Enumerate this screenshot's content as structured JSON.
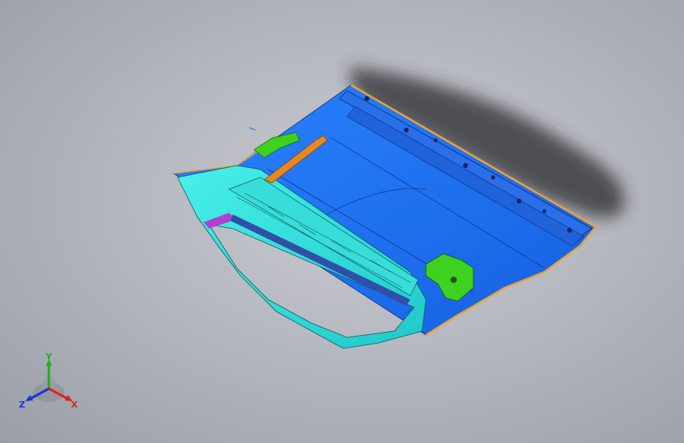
{
  "viewport": {
    "background_top": "#c9cbd0",
    "background_bottom": "#9a9ea7"
  },
  "model": {
    "panel_color": "#1e74f5",
    "frame_color": "#2fe6e0",
    "bracket_color": "#3fd11f",
    "edge_color": "#f0a030",
    "shadow_color": "#2a2a2e"
  },
  "triad": {
    "x_label": "X",
    "y_label": "Y",
    "z_label": "Z",
    "x_color": "#e02020",
    "y_color": "#20b020",
    "z_color": "#2030e0"
  }
}
